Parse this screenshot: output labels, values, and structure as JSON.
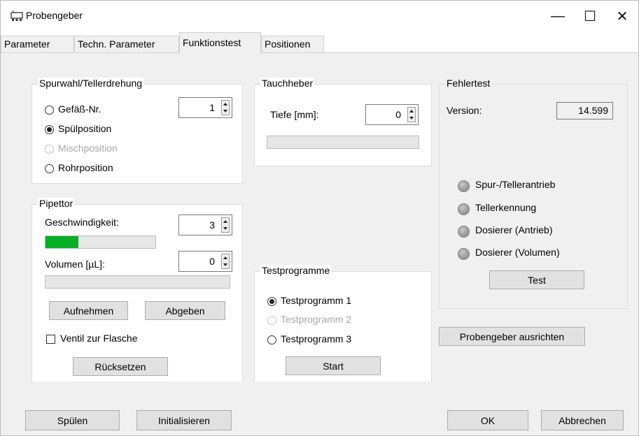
{
  "window": {
    "title": "Probengeber",
    "minimize": "—",
    "maximize": "☐",
    "close": "✕"
  },
  "tabs": [
    "Parameter",
    "Techn. Parameter",
    "Funktionstest",
    "Positionen"
  ],
  "spur": {
    "title": "Spurwahl/Tellerdrehung",
    "options": [
      {
        "label": "Gefäß-Nr.",
        "checked": false,
        "disabled": false
      },
      {
        "label": "Spülposition",
        "checked": true,
        "disabled": false
      },
      {
        "label": "Mischposition",
        "checked": false,
        "disabled": true
      },
      {
        "label": "Rohrposition",
        "checked": false,
        "disabled": false
      }
    ],
    "vessel_value": "1"
  },
  "tauchheber": {
    "title": "Tauchheber",
    "depth_label": "Tiefe [mm]:",
    "depth_value": "0",
    "progress": 0
  },
  "fehlertest": {
    "title": "Fehlertest",
    "version_label": "Version:",
    "version_value": "14.599",
    "indicators": [
      "Spur-/Tellerantrieb",
      "Tellerkennung",
      "Dosierer (Antrieb)",
      "Dosierer (Volumen)"
    ],
    "test_button": "Test"
  },
  "pipettor": {
    "title": "Pipettor",
    "speed_label": "Geschwindigkeit:",
    "speed_value": "3",
    "speed_progress": 0.3,
    "volume_label": "Volumen [µL]:",
    "volume_value": "0",
    "volume_progress": 0,
    "aufnehmen": "Aufnehmen",
    "abgeben": "Abgeben",
    "ventil_label": "Ventil zur Flasche",
    "ventil_checked": false,
    "reset": "Rücksetzen"
  },
  "testprogramme": {
    "title": "Testprogramme",
    "options": [
      {
        "label": "Testprogramm 1",
        "checked": true,
        "disabled": false
      },
      {
        "label": "Testprogramm 2",
        "checked": false,
        "disabled": true
      },
      {
        "label": "Testprogramm 3",
        "checked": false,
        "disabled": false
      }
    ],
    "start": "Start"
  },
  "align_button": "Probengeber ausrichten",
  "footer": {
    "spuelen": "Spülen",
    "initialisieren": "Initialisieren",
    "ok": "OK",
    "abbrechen": "Abbrechen"
  },
  "colors": {
    "progress_fill": "#06b025",
    "led": "#9a9a9a"
  }
}
